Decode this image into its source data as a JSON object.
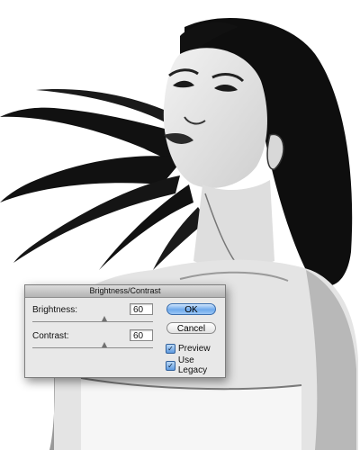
{
  "dialog": {
    "title": "Brightness/Contrast",
    "brightness": {
      "label": "Brightness:",
      "value": "60",
      "level": 0.6
    },
    "contrast": {
      "label": "Contrast:",
      "value": "60",
      "level": 0.6
    },
    "ok_label": "OK",
    "cancel_label": "Cancel",
    "preview": {
      "label": "Preview",
      "checked": true
    },
    "use_legacy": {
      "label": "Use Legacy",
      "checked": true
    }
  },
  "icons": {
    "checkmark": "check-icon",
    "slider_thumb": "triangle-thumb-icon"
  },
  "colors": {
    "ok_button": "#6ea9ec",
    "dialog_bg": "#e8e8e8",
    "checkbox": "#5e9ae0"
  }
}
